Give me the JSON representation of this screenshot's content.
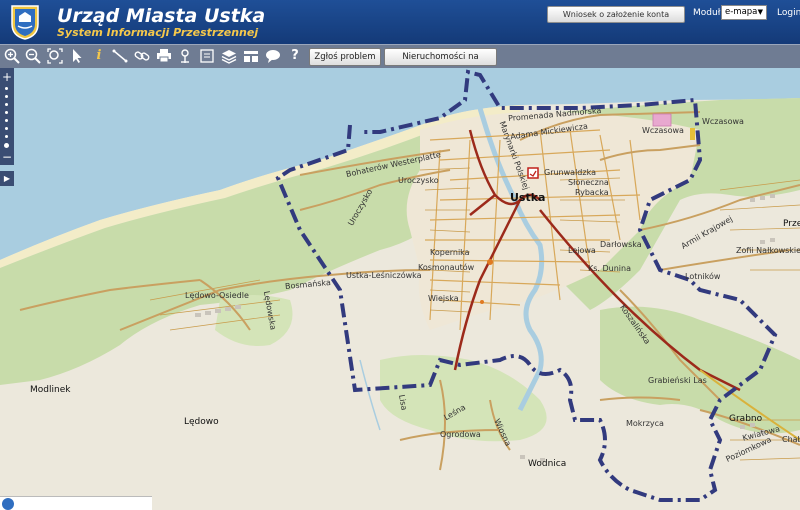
{
  "header": {
    "title": "Urząd Miasta Ustka",
    "subtitle": "System Informacji Przestrzennej",
    "account_button": "Wniosek o założenie konta",
    "module_label": "Moduł",
    "module_value": "e-mapa",
    "login": "Login"
  },
  "toolbar": {
    "icons": [
      "zoom-in-icon",
      "zoom-out-icon",
      "zoom-extent-icon",
      "select-arrow-icon",
      "info-icon",
      "measure-icon",
      "link-icon",
      "print-icon",
      "locate-icon",
      "export-icon",
      "layers-icon",
      "legend-icon",
      "comment-icon",
      "help-icon"
    ],
    "report_problem": "Zgłoś problem",
    "real_estate": "Nieruchomości na sprzedaż"
  },
  "zoom": {
    "plus": "+",
    "minus": "−"
  },
  "map": {
    "labels": {
      "ustka": "Ustka",
      "modlinek": "Modlinek",
      "ledowo": "Lędowo",
      "wodnica": "Wodnica",
      "grabno": "Grabno",
      "ledowo_osiedle": "Lędowo-Osiedle",
      "ustka_lesniczowka": "Ustka-Leśniczówka",
      "bosmanska": "Bosmańska",
      "ledowska": "Lędowska",
      "bohaterow_westerplatte": "Bohaterów Westerplatte",
      "uroczysko1": "Uroczysko",
      "uroczysko2": "Uroczysko",
      "promenada": "Promenada Nadmorska",
      "adama_mickiewicza": "Adama Mickiewicza",
      "marynarki": "Marynarki Polskiej",
      "wczasowa": "Wczasowa",
      "wczasowa2": "Wczasowa",
      "armii_krajowej": "Armii Krajowej",
      "zofii": "Zofii Nałkowskiej",
      "lotnikow": "Lotników",
      "grabienski_las": "Grabieński Las",
      "mokrzyca": "Mokrzyca",
      "lesna": "Leśna",
      "ogrodowa": "Ogrodowa",
      "wiosna": "Wiosna",
      "kwiatowa": "Kwiatowa",
      "poziomkowa": "Poziomkowa",
      "chabrowa": "Chabrowa",
      "przem": "Prze",
      "lisa": "Lisa",
      "sloneczna": "Słoneczna",
      "darlowska": "Darłowska",
      "grunwaldzka": "Grunwaldzka",
      "kopernika": "Kopernika",
      "koszalinska": "Koszalińska",
      "rybacka": "Rybacka",
      "lejowa": "Lejowa",
      "dunina": "Ks. Dunina",
      "kosmonautow": "Kosmonautów",
      "wiejska": "Wiejska"
    }
  }
}
